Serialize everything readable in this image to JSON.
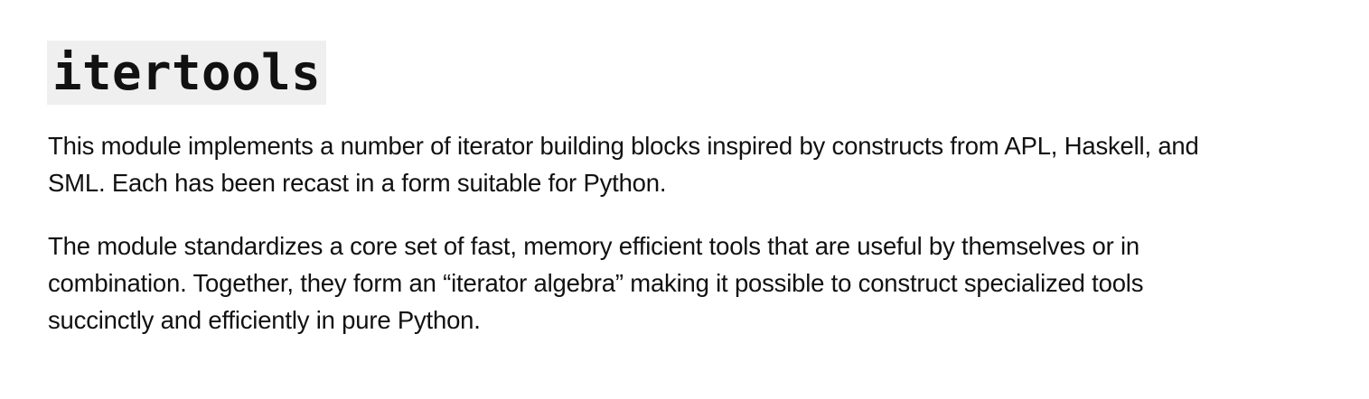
{
  "title": "itertools",
  "paragraphs": [
    {
      "lines": [
        "This module implements a number of iterator building blocks inspired by constructs from APL, Haskell, and",
        "SML. Each has been recast in a form suitable for Python."
      ]
    },
    {
      "lines": [
        "The module standardizes a core set of fast, memory efficient tools that are useful by themselves or in",
        "combination. Together, they form an “iterator algebra” making it possible to construct specialized tools",
        "succinctly and efficiently in pure Python."
      ]
    }
  ]
}
